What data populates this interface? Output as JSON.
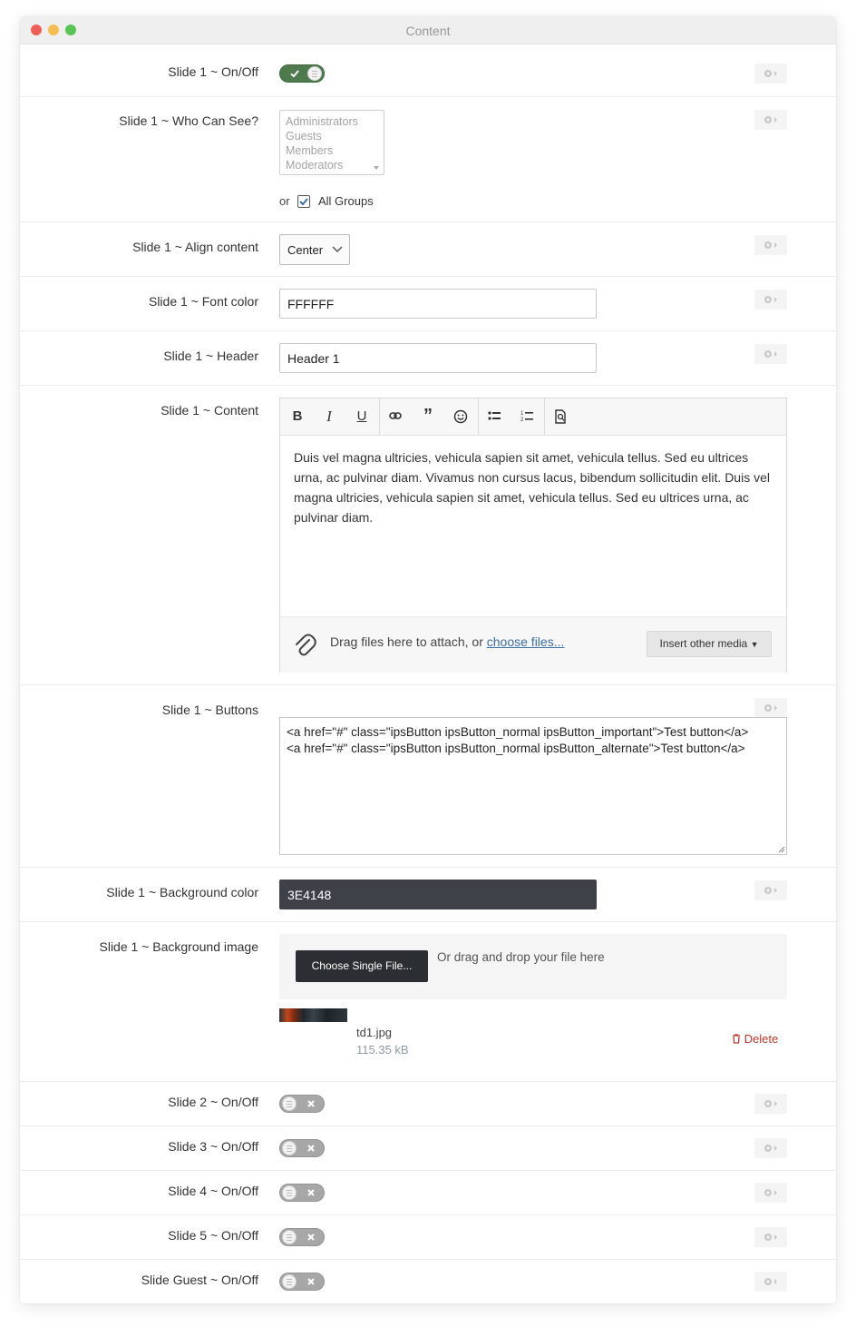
{
  "window": {
    "title": "Content"
  },
  "rows": {
    "slide1_onoff": {
      "label": "Slide 1 ~ On/Off",
      "on": true
    },
    "slide1_whocansee": {
      "label": "Slide 1 ~ Who Can See?",
      "options": [
        "Administrators",
        "Guests",
        "Members",
        "Moderators"
      ],
      "or_text": "or",
      "all_groups_label": "All Groups",
      "all_groups_checked": true
    },
    "slide1_align": {
      "label": "Slide 1 ~ Align content",
      "value": "Center"
    },
    "slide1_fontcolor": {
      "label": "Slide 1 ~ Font color",
      "value": "FFFFFF"
    },
    "slide1_header": {
      "label": "Slide 1 ~ Header",
      "value": "Header 1"
    },
    "slide1_content": {
      "label": "Slide 1 ~ Content",
      "text": "Duis vel magna ultricies, vehicula sapien sit amet, vehicula tellus. Sed eu ultrices urna, ac pulvinar diam. Vivamus non cursus lacus, bibendum sollicitudin elit. Duis vel magna ultricies, vehicula sapien sit amet, vehicula tellus. Sed eu ultrices urna, ac pulvinar diam.",
      "drop_text": "Drag files here to attach, or ",
      "choose_link": "choose files...",
      "insert_media": "Insert other media"
    },
    "slide1_buttons": {
      "label": "Slide 1 ~ Buttons",
      "line1": "<a href=\"#\" class=\"ipsButton ipsButton_normal ipsButton_important\">Test button</a>",
      "line2": "<a href=\"#\" class=\"ipsButton ipsButton_normal ipsButton_alternate\">Test button</a>"
    },
    "slide1_bgcolor": {
      "label": "Slide 1 ~ Background color",
      "value": "3E4148"
    },
    "slide1_bgimage": {
      "label": "Slide 1 ~ Background image",
      "choose_button": "Choose Single File...",
      "hint": "Or drag and drop your file here",
      "file_name": "td1.jpg",
      "file_size": "115.35 kB",
      "delete_label": "Delete"
    },
    "slide2_onoff": {
      "label": "Slide 2 ~ On/Off",
      "on": false
    },
    "slide3_onoff": {
      "label": "Slide 3 ~ On/Off",
      "on": false
    },
    "slide4_onoff": {
      "label": "Slide 4 ~ On/Off",
      "on": false
    },
    "slide5_onoff": {
      "label": "Slide 5 ~ On/Off",
      "on": false
    },
    "slideguest_onoff": {
      "label": "Slide Guest ~ On/Off",
      "on": false
    }
  },
  "colors": {
    "toggle_on": "#4e7a4e",
    "toggle_off": "#a7a7a7",
    "dark_input": "#3e4148",
    "delete": "#c0392b",
    "link": "#3a6ea5"
  }
}
